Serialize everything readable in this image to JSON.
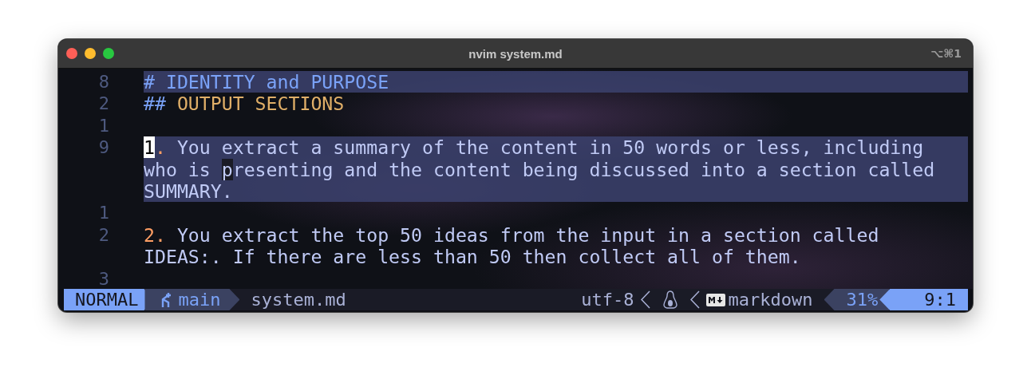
{
  "window": {
    "title": "nvim system.md",
    "shortcut": "⌥⌘1"
  },
  "lines": [
    {
      "number": "8",
      "highlighted": true,
      "rows": [
        {
          "segments": [
            {
              "text": "# IDENTITY and PURPOSE",
              "kind": "h1"
            }
          ]
        }
      ]
    },
    {
      "number": "2",
      "highlighted": false,
      "rows": [
        {
          "segments": [
            {
              "text": "## ",
              "kind": "hmark"
            },
            {
              "text": "OUTPUT SECTIONS",
              "kind": "h2"
            }
          ]
        }
      ]
    },
    {
      "number": "1",
      "highlighted": false,
      "rows": [
        {
          "segments": []
        }
      ]
    },
    {
      "number": "9",
      "highlighted": true,
      "rows": [
        {
          "segments": [
            {
              "text": "1",
              "kind": "cursor"
            },
            {
              "text": ".",
              "kind": "list"
            },
            {
              "text": " You extract a summary of the content in 50 words or less, including",
              "kind": "plain"
            }
          ]
        },
        {
          "segments": [
            {
              "text": "who is ",
              "kind": "plain"
            },
            {
              "text": "p",
              "kind": "match"
            },
            {
              "text": "resenting and the content being discussed into a section called",
              "kind": "plain"
            }
          ]
        },
        {
          "segments": [
            {
              "text": "SUMMARY.",
              "kind": "plain"
            }
          ]
        }
      ]
    },
    {
      "number": "1",
      "highlighted": false,
      "rows": [
        {
          "segments": []
        }
      ]
    },
    {
      "number": "2",
      "highlighted": false,
      "rows": [
        {
          "segments": [
            {
              "text": "2.",
              "kind": "list"
            },
            {
              "text": " You extract the top 50 ideas from the input in a section called",
              "kind": "plain"
            }
          ]
        },
        {
          "segments": [
            {
              "text": "IDEAS:. If there are less than 50 then collect all of them.",
              "kind": "plain"
            }
          ]
        }
      ]
    },
    {
      "number": "3",
      "highlighted": false,
      "rows": [
        {
          "segments": []
        }
      ]
    }
  ],
  "statusline": {
    "mode": "NORMAL",
    "branch": "main",
    "file": "system.md",
    "encoding": "utf-8",
    "filetype": "markdown",
    "progress": "31%",
    "position": "9:1"
  }
}
